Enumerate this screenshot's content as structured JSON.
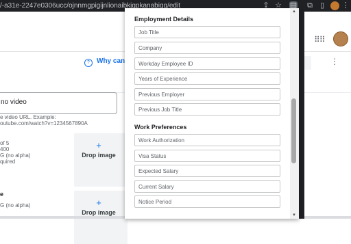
{
  "browser": {
    "url_fragment": "/-a31e-2247e0306ucc/ojnnmgpigijnlionaibkjgpkanabigg/edit"
  },
  "page": {
    "help_link_label": "Why can",
    "video_input_value": "no video",
    "video_helper_lines": [
      "e video URL. Example:",
      "outube.com/watch?v=1234567890A"
    ],
    "image_helper_lines": [
      "of 5",
      "400",
      "G (no alpha)",
      "quired"
    ],
    "drop_label": "Drop image",
    "second_section_fragment": "e",
    "second_helper": "G (no alpha)"
  },
  "popup": {
    "employment_title": "Employment Details",
    "employment_fields": [
      "Job Title",
      "Company",
      "Workday Employee ID",
      "Years of Experience",
      "Previous Employer",
      "Previous Job Title"
    ],
    "preferences_title": "Work Preferences",
    "preference_fields": [
      "Work Authorization",
      "Visa Status",
      "Expected Salary",
      "Current Salary",
      "Notice Period"
    ]
  }
}
